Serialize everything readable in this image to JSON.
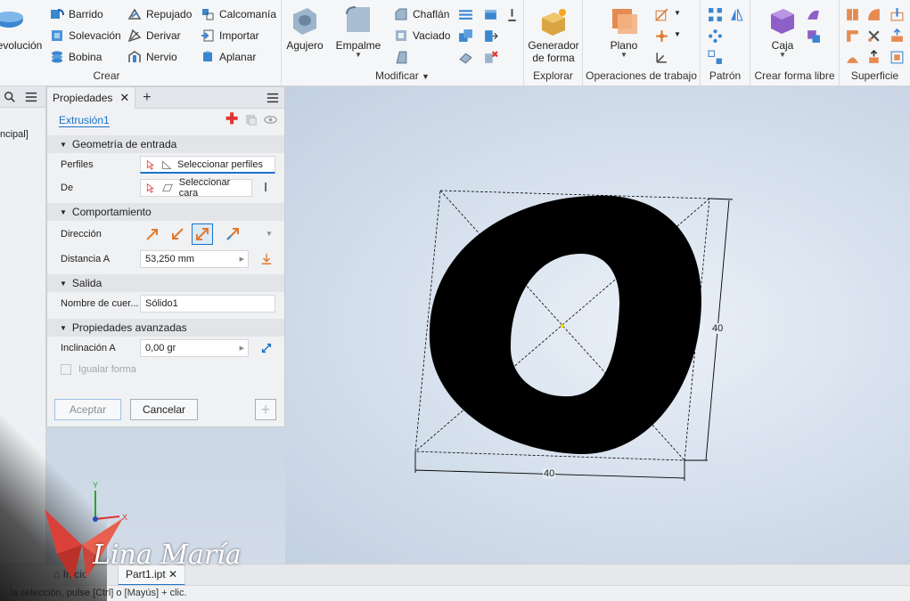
{
  "ribbon": {
    "groups": {
      "crear": {
        "label": "Crear",
        "revolucion": "evolución",
        "barrido": "Barrido",
        "solevacion": "Solevación",
        "bobina": "Bobina",
        "repujado": "Repujado",
        "derivar": "Derivar",
        "nervio": "Nervio",
        "calcomania": "Calcomanía",
        "importar": "Importar",
        "aplanar": "Aplanar"
      },
      "modificar": {
        "label": "Modificar",
        "agujero": "Agujero",
        "empalme": "Empalme",
        "chaflan": "Chaflán",
        "vaciado": "Vaciado"
      },
      "explorar": {
        "label": "Explorar",
        "generador": "Generador",
        "generador2": "de forma"
      },
      "operaciones": {
        "label": "Operaciones de trabajo",
        "plano": "Plano"
      },
      "patron": {
        "label": "Patrón"
      },
      "forma_libre": {
        "label": "Crear forma libre",
        "caja": "Caja"
      },
      "superficie": {
        "label": "Superficie"
      }
    }
  },
  "browser": {
    "partial_label": "ncipal]"
  },
  "properties": {
    "tab_title": "Propiedades",
    "feature_name": "Extrusión1",
    "sections": {
      "entrada": "Geometría de entrada",
      "comportamiento": "Comportamiento",
      "salida": "Salida",
      "avanzadas": "Propiedades avanzadas"
    },
    "perfiles_label": "Perfiles",
    "perfiles_value": "Seleccionar perfiles",
    "de_label": "De",
    "de_value": "Seleccionar cara",
    "direccion_label": "Dirección",
    "distancia_label": "Distancia A",
    "distancia_value": "53,250 mm",
    "nombre_label": "Nombre de cuer...",
    "nombre_value": "Sólido1",
    "inclinacion_label": "Inclinación A",
    "inclinacion_value": "0,00 gr",
    "igualar_label": "Igualar forma",
    "aceptar": "Aceptar",
    "cancelar": "Cancelar"
  },
  "viewport": {
    "dim_horizontal": "40",
    "dim_vertical": "40",
    "axis_y": "Y",
    "axis_x": "X"
  },
  "doc_tabs": {
    "tab1": "Inicio",
    "tab2": "Part1.ipt"
  },
  "status": {
    "text": "...la selección, pulse [Ctrl] o [Mayús] + clic."
  },
  "watermark": {
    "text": "Lina María"
  },
  "colors": {
    "accent": "#1a73c8",
    "profile": "#000000",
    "viewport_bg": "#d4dfec"
  }
}
